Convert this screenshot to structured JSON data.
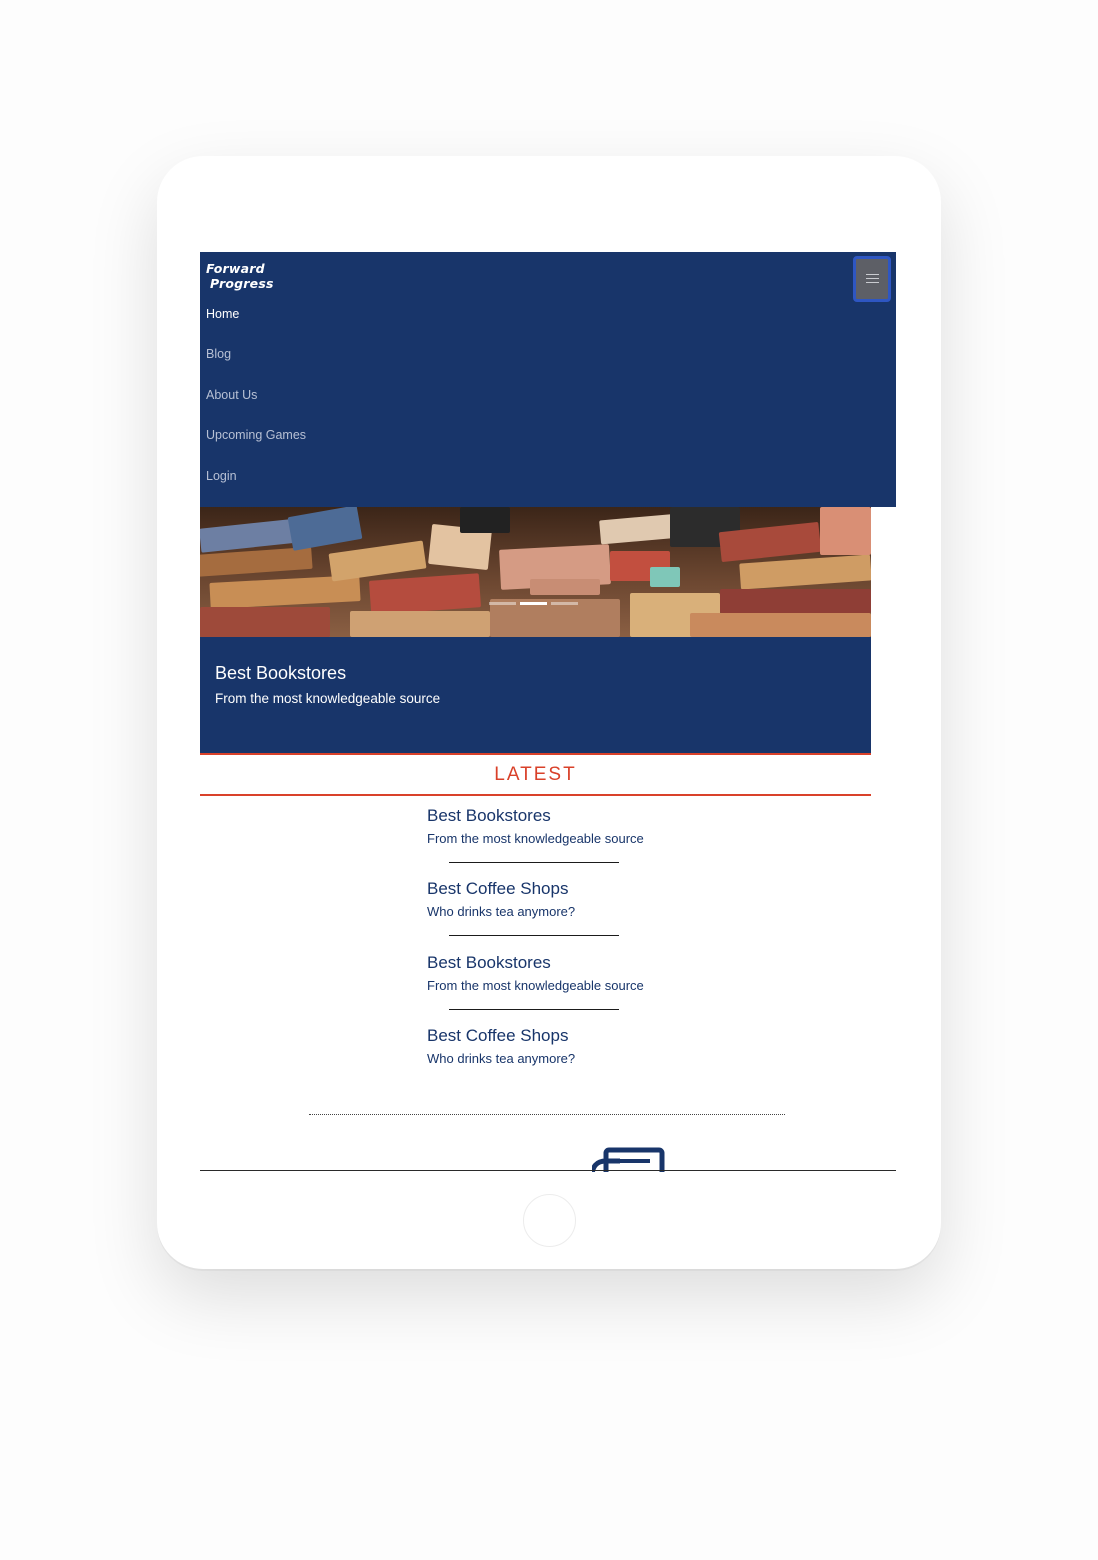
{
  "brand": {
    "line1": "Forward",
    "line2": "Progress"
  },
  "nav": {
    "items": [
      {
        "label": "Home",
        "active": true
      },
      {
        "label": "Blog",
        "active": false
      },
      {
        "label": "About Us",
        "active": false
      },
      {
        "label": "Upcoming Games",
        "active": false
      },
      {
        "label": "Login",
        "active": false
      }
    ],
    "toggler_icon": "hamburger-icon"
  },
  "carousel": {
    "active_slide": 2,
    "slide_count": 3,
    "caption_title": "Best Bookstores",
    "caption_text": "From the most knowledgeable source"
  },
  "latest": {
    "heading": "LATEST",
    "articles": [
      {
        "title": "Best Bookstores",
        "subtitle": "From the most knowledgeable source"
      },
      {
        "title": "Best Coffee Shops",
        "subtitle": "Who drinks tea anymore?"
      },
      {
        "title": "Best Bookstores",
        "subtitle": "From the most knowledgeable source"
      },
      {
        "title": "Best Coffee Shops",
        "subtitle": "Who drinks tea anymore?"
      }
    ]
  },
  "footer": {
    "icon": "newspaper-icon"
  },
  "colors": {
    "navy": "#18356a",
    "accent_red": "#d9412a",
    "toggler_bg": "#5d5f66",
    "toggler_border": "#2e56c2"
  }
}
